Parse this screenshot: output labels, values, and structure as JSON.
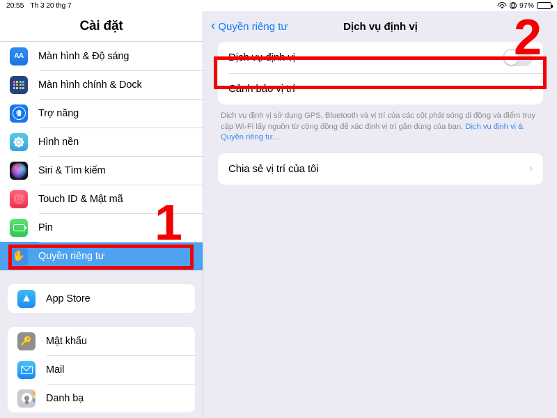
{
  "status_bar": {
    "time": "20:55",
    "date": "Th 3 20 thg 7",
    "wifi_icon": "wifi-icon",
    "lock_icon": "rotation-lock-icon",
    "battery_percent": "97%",
    "battery_icon": "battery-icon"
  },
  "sidebar": {
    "title": "Cài đặt",
    "groups": [
      {
        "items": [
          {
            "label": "Màn hình & Độ sáng",
            "icon": "display-brightness-icon",
            "selected": false
          },
          {
            "label": "Màn hình chính & Dock",
            "icon": "home-screen-dock-icon",
            "selected": false
          },
          {
            "label": "Trợ năng",
            "icon": "accessibility-icon",
            "selected": false
          },
          {
            "label": "Hình nền",
            "icon": "wallpaper-icon",
            "selected": false
          },
          {
            "label": "Siri & Tìm kiếm",
            "icon": "siri-search-icon",
            "selected": false
          },
          {
            "label": "Touch ID & Mật mã",
            "icon": "touch-id-icon",
            "selected": false
          },
          {
            "label": "Pin",
            "icon": "battery-settings-icon",
            "selected": false
          },
          {
            "label": "Quyền riêng tư",
            "icon": "privacy-hand-icon",
            "selected": true
          }
        ]
      },
      {
        "items": [
          {
            "label": "App Store",
            "icon": "app-store-icon",
            "selected": false
          }
        ]
      },
      {
        "items": [
          {
            "label": "Mật khẩu",
            "icon": "passwords-key-icon",
            "selected": false
          },
          {
            "label": "Mail",
            "icon": "mail-icon",
            "selected": false
          },
          {
            "label": "Danh bạ",
            "icon": "contacts-icon",
            "selected": false
          }
        ]
      }
    ]
  },
  "detail": {
    "back_label": "Quyền riêng tư",
    "back_chevron": "chevron-left-icon",
    "title": "Dịch vụ định vị",
    "rows": [
      {
        "label": "Dịch vụ định vị",
        "control": "toggle",
        "value": "off"
      },
      {
        "label": "Cảnh báo vị trí",
        "control": "chevron",
        "value": ""
      }
    ],
    "footer_text": "Dịch vụ định vị sử dụng GPS, Bluetooth và vị trí của các cột phát sóng di động và điểm truy cập Wi-Fi lấy nguồn từ cộng đồng để xác định vị trí gần đúng của bạn. ",
    "footer_link": "Dịch vụ định vị & Quyền riêng tư...",
    "share_row": {
      "label": "Chia sẻ vị trí của tôi",
      "control": "chevron"
    }
  },
  "annotations": {
    "marker_one": "1",
    "marker_two": "2",
    "color": "#f40000"
  }
}
